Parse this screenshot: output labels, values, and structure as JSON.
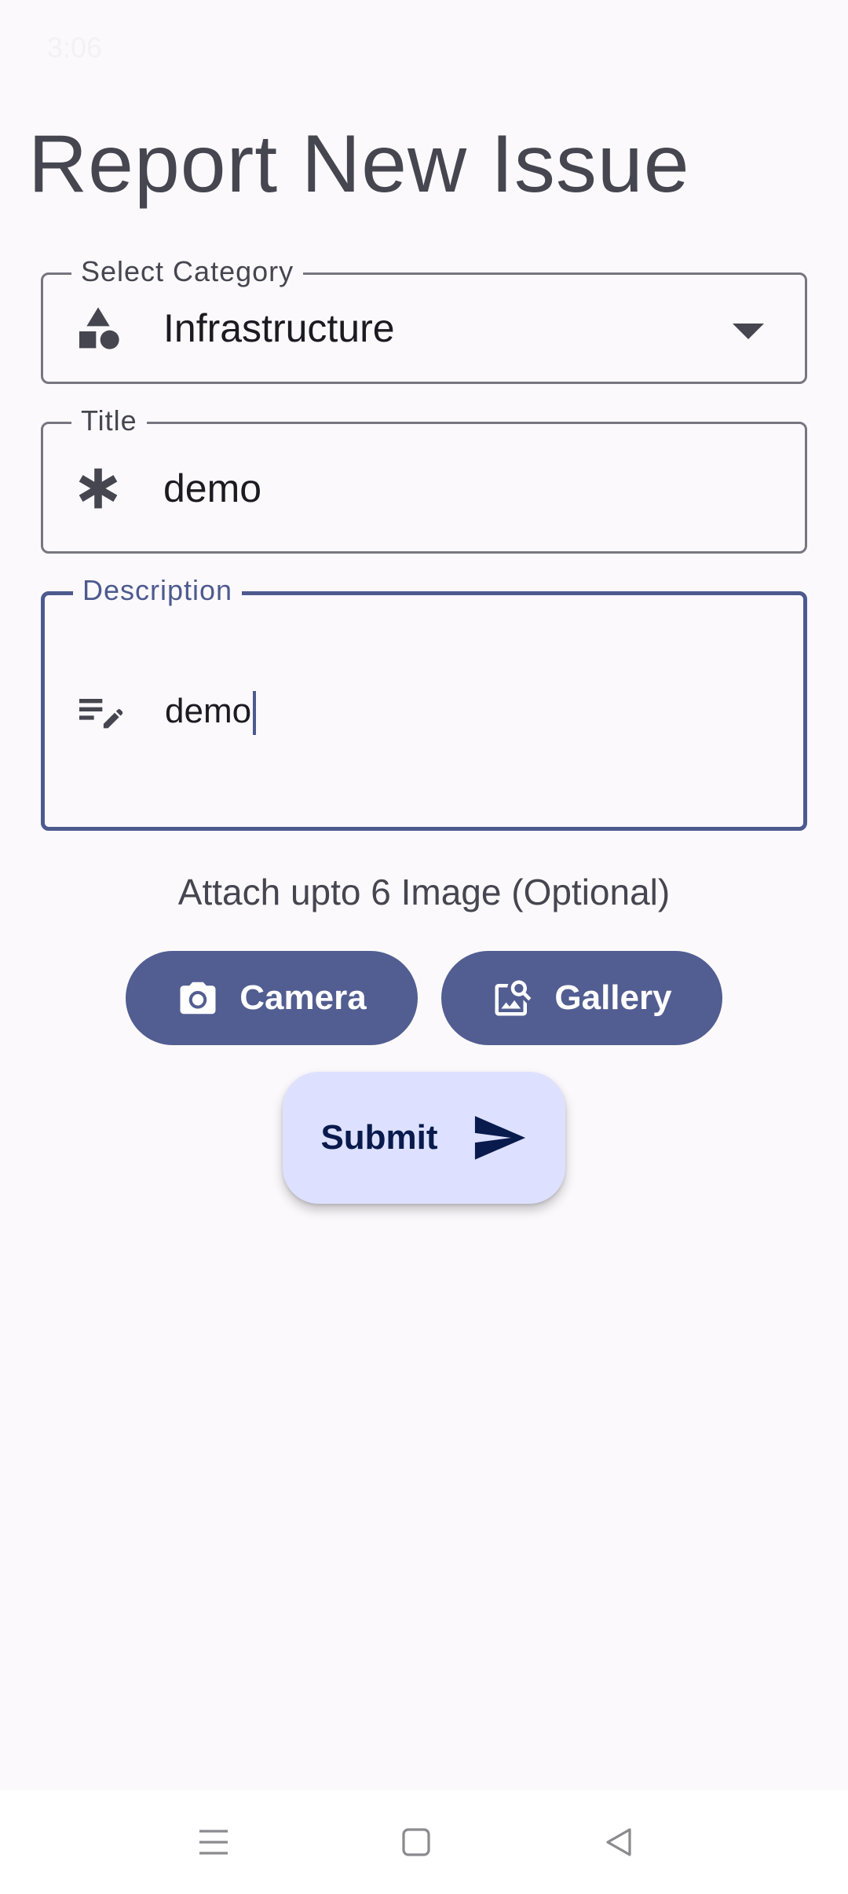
{
  "status_bar": {
    "time": "3:06"
  },
  "page": {
    "title": "Report New Issue"
  },
  "form": {
    "category": {
      "label": "Select Category",
      "value": "Infrastructure",
      "icon": "category-icon"
    },
    "title_field": {
      "label": "Title",
      "value": "demo",
      "icon": "asterisk-icon"
    },
    "description": {
      "label": "Description",
      "value": "demo",
      "icon": "edit-note-icon"
    },
    "attach_text": "Attach upto 6 Image (Optional)",
    "camera_label": "Camera",
    "gallery_label": "Gallery",
    "submit_label": "Submit"
  },
  "colors": {
    "primary": "#525e91",
    "focus_outline": "#4d5a8e",
    "submit_bg": "#dde1ff",
    "background": "#fcf9fd"
  },
  "nav": {
    "icons": [
      "menu-icon",
      "home-square-icon",
      "back-triangle-icon"
    ]
  }
}
